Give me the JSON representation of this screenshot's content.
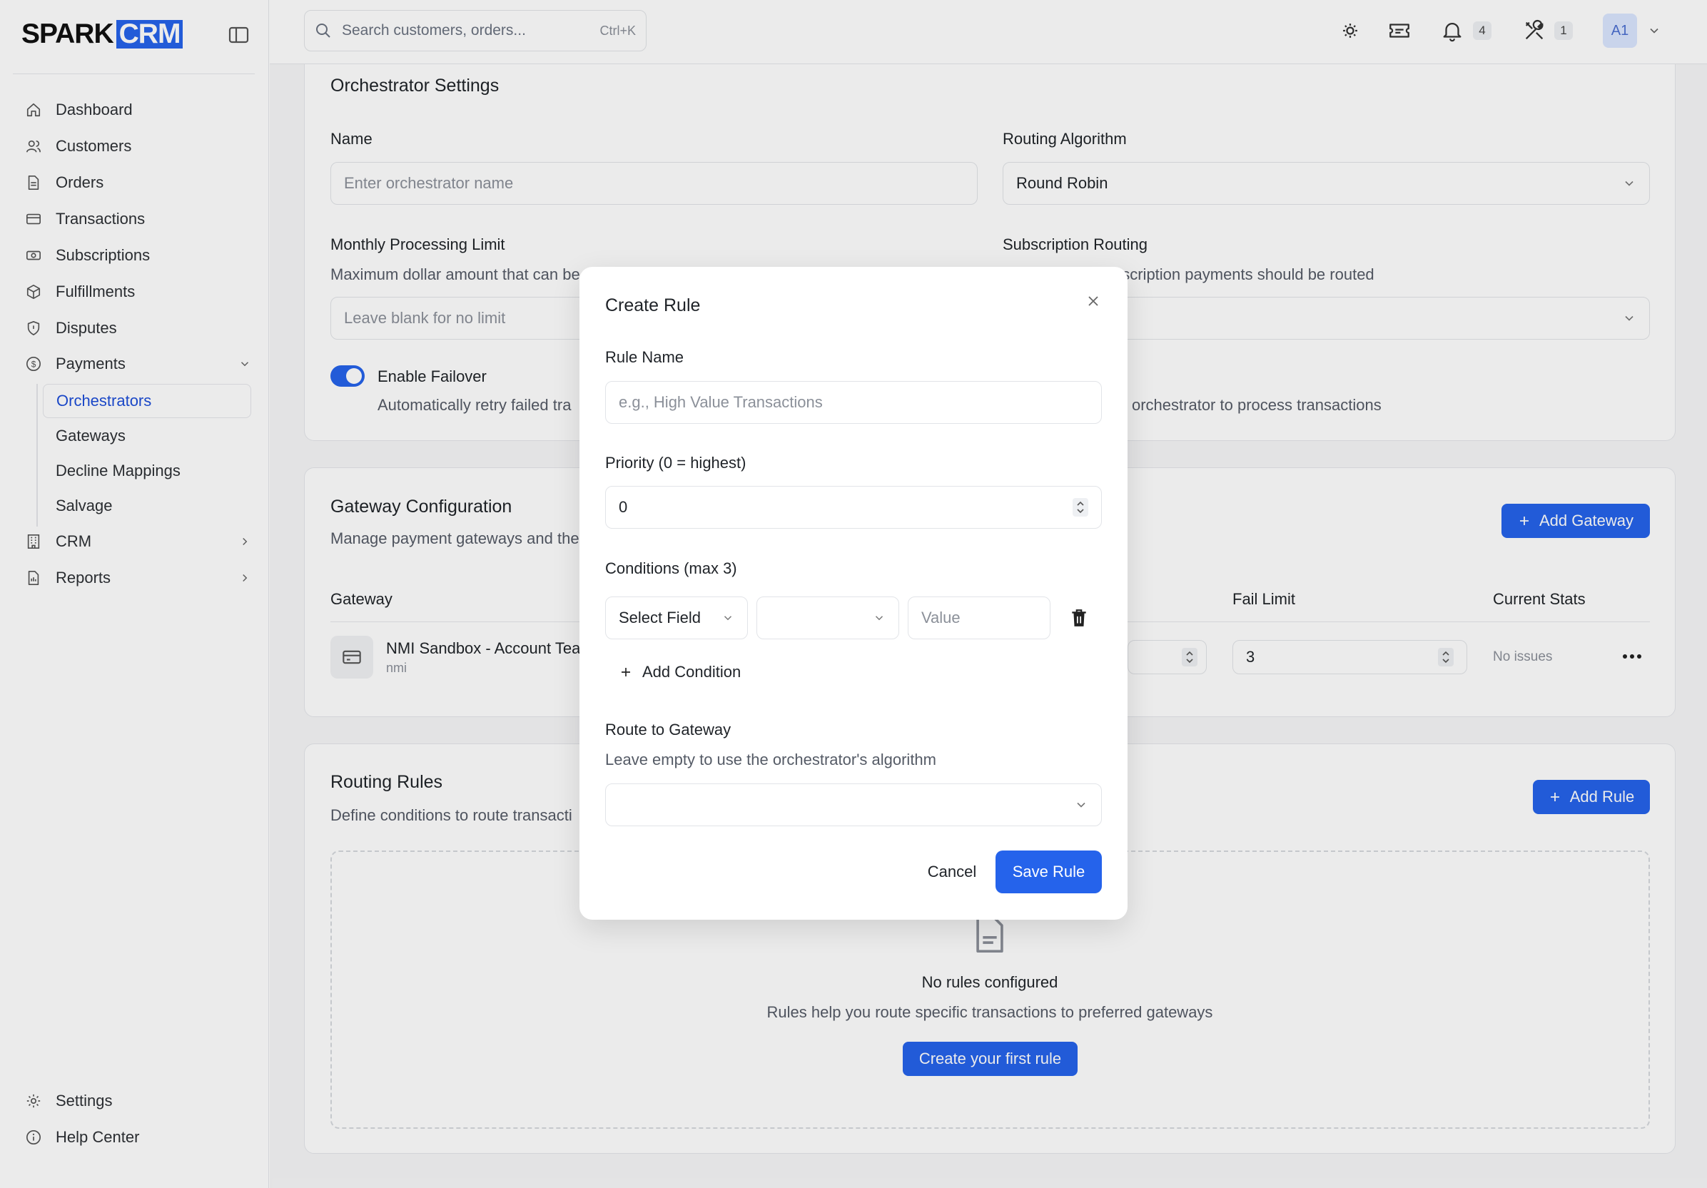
{
  "brand": {
    "part1": "SPARK",
    "part2": "CRM"
  },
  "search": {
    "placeholder": "Search customers, orders...",
    "shortcut": "Ctrl+K"
  },
  "topbar": {
    "notifications_count": "4",
    "tools_count": "1",
    "avatar_initials": "A1"
  },
  "sidebar": {
    "items": [
      {
        "label": "Dashboard",
        "icon": "home-icon"
      },
      {
        "label": "Customers",
        "icon": "users-icon"
      },
      {
        "label": "Orders",
        "icon": "document-icon"
      },
      {
        "label": "Transactions",
        "icon": "credit-card-icon"
      },
      {
        "label": "Subscriptions",
        "icon": "banknote-icon"
      },
      {
        "label": "Fulfillments",
        "icon": "box-icon"
      },
      {
        "label": "Disputes",
        "icon": "shield-icon"
      },
      {
        "label": "Payments",
        "icon": "dollar-circle-icon"
      }
    ],
    "payments_sub": [
      "Orchestrators",
      "Gateways",
      "Decline Mappings",
      "Salvage"
    ],
    "crm": "CRM",
    "reports": "Reports",
    "settings": "Settings",
    "help": "Help Center"
  },
  "orchestrator": {
    "title": "Orchestrator Settings",
    "name_label": "Name",
    "name_placeholder": "Enter orchestrator name",
    "routing_label": "Routing Algorithm",
    "routing_value": "Round Robin",
    "monthly_label": "Monthly Processing Limit",
    "monthly_help": "Maximum dollar amount that can be",
    "monthly_placeholder": "Leave blank for no limit",
    "sub_routing_label": "Subscription Routing",
    "sub_routing_help": "bscription payments should be routed",
    "failover_label": "Enable Failover",
    "failover_help": "Automatically retry failed tra",
    "active_help": "orchestrator to process transactions"
  },
  "gateway": {
    "title": "Gateway Configuration",
    "subtitle": "Manage payment gateways and the",
    "add_button": "Add Gateway",
    "col_gateway": "Gateway",
    "col_fail_limit": "Fail Limit",
    "col_current_stats": "Current Stats",
    "row_name": "NMI Sandbox - Account Tea",
    "row_type": "nmi",
    "row_fail_limit": "3",
    "row_stats": "No issues"
  },
  "rules": {
    "title": "Routing Rules",
    "subtitle": "Define conditions to route transacti",
    "add_button": "Add Rule",
    "empty_title": "No rules configured",
    "empty_help": "Rules help you route specific transactions to preferred gateways",
    "empty_button": "Create your first rule"
  },
  "modal": {
    "title": "Create Rule",
    "rule_name_label": "Rule Name",
    "rule_name_placeholder": "e.g., High Value Transactions",
    "priority_label": "Priority (0 = highest)",
    "priority_value": "0",
    "conditions_label": "Conditions (max 3)",
    "field_select": "Select Field",
    "value_placeholder": "Value",
    "add_condition": "Add Condition",
    "route_label": "Route to Gateway",
    "route_help": "Leave empty to use the orchestrator's algorithm",
    "cancel": "Cancel",
    "save": "Save Rule"
  },
  "colors": {
    "accent": "#2563eb",
    "background": "#f7f7f8"
  }
}
